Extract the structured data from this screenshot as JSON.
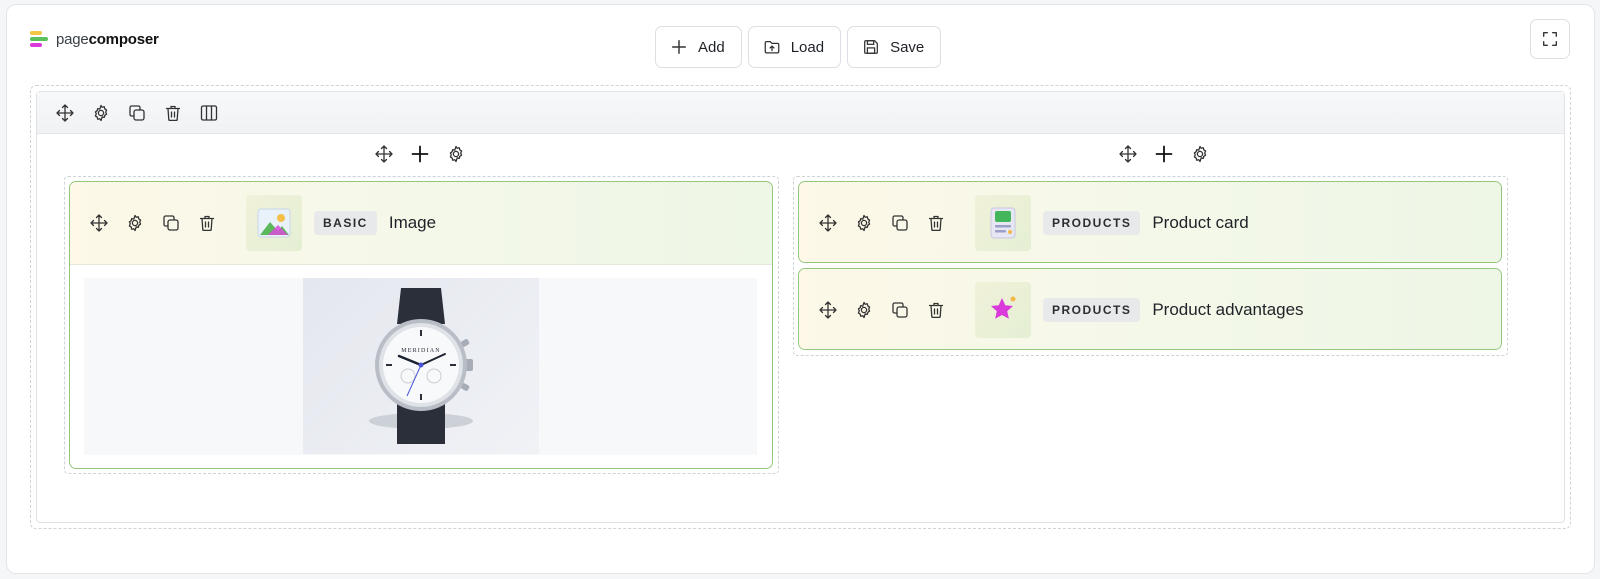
{
  "brand": {
    "prefix": "page",
    "suffix": "composer"
  },
  "toolbar": {
    "add_label": "Add",
    "load_label": "Load",
    "save_label": "Save"
  },
  "left_column": {
    "blocks": [
      {
        "category": "BASIC",
        "title": "Image",
        "icon": "image-thumb-icon"
      }
    ],
    "image": {
      "brand_text": "MERIDIAN"
    }
  },
  "right_column": {
    "blocks": [
      {
        "category": "PRODUCTS",
        "title": "Product card",
        "icon": "product-card-thumb-icon"
      },
      {
        "category": "PRODUCTS",
        "title": "Product advantages",
        "icon": "star-thumb-icon"
      }
    ]
  },
  "colors": {
    "block_border": "#93c77e",
    "accent_green": "#5cc15d",
    "accent_yellow": "#f2c744",
    "accent_magenta": "#d93ad9"
  }
}
